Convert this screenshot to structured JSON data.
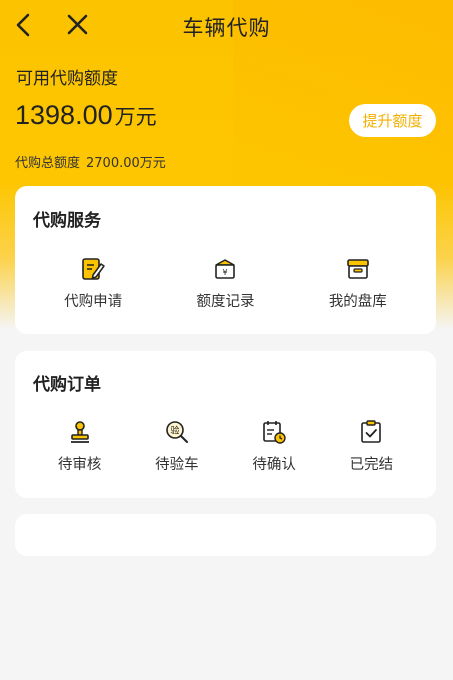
{
  "header": {
    "title": "车辆代购",
    "back_icon": "chevron-left-icon",
    "close_icon": "close-icon"
  },
  "quota": {
    "label": "可用代购额度",
    "amount": "1398.00",
    "unit": "万元",
    "raise_button": "提升额度",
    "total_label": "代购总额度",
    "total_value": "2700.00万元"
  },
  "services": {
    "title": "代购服务",
    "items": [
      {
        "label": "代购申请",
        "icon": "edit-form-icon"
      },
      {
        "label": "额度记录",
        "icon": "money-box-icon"
      },
      {
        "label": "我的盘库",
        "icon": "inventory-box-icon"
      }
    ]
  },
  "orders": {
    "title": "代购订单",
    "items": [
      {
        "label": "待审核",
        "icon": "stamp-icon"
      },
      {
        "label": "待验车",
        "icon": "inspect-search-icon"
      },
      {
        "label": "待确认",
        "icon": "calendar-clock-icon"
      },
      {
        "label": "已完结",
        "icon": "clipboard-check-icon"
      }
    ]
  },
  "colors": {
    "accent": "#fcc400",
    "accent_text": "#f2b000",
    "background": "#f5f5f6"
  }
}
